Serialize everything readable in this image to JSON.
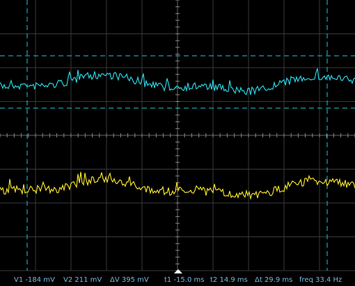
{
  "colors": {
    "background": "#000000",
    "grid": "#3a3a3a",
    "cursor": "#22c7d8",
    "channel1": "#2ad4e4",
    "channel2": "#f2e22a",
    "readout_text": "#7fb8e0"
  },
  "readouts": {
    "v1": "V1 -184 mV",
    "v2": "V2 211 mV",
    "dv": "ΔV 395 mV",
    "t1": "t1 -15.0 ms",
    "t2": "t2 14.9 ms",
    "dt": "Δt 29.9 ms",
    "freq": "freq 33.4 Hz"
  },
  "icons": {
    "trigger_marker": "trigger-position-marker"
  },
  "waveforms": {
    "channel1": {
      "name": "channel-1-trace",
      "seed": 7
    },
    "channel2": {
      "name": "channel-2-trace",
      "seed": 19
    }
  }
}
